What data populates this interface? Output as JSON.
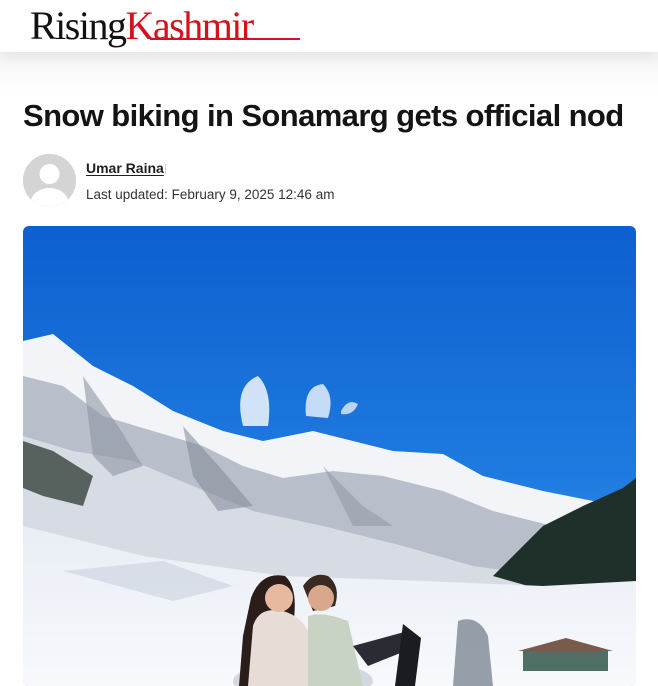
{
  "site": {
    "logo_word1": "Rising",
    "logo_word2": "Kashmir",
    "logo_color": "#d1141c"
  },
  "article": {
    "title": "Snow biking in Sonamarg gets official nod",
    "author": "Umar Raina",
    "updated_label": "Last updated:",
    "updated_date": "February 9, 2025 12:46 am"
  },
  "icons": {
    "avatar": "default-user-avatar-icon",
    "separator": "meta-divider"
  },
  "hero_image": {
    "subject": "two people on a snow bike in front of snow-covered mountains under a blue sky"
  }
}
